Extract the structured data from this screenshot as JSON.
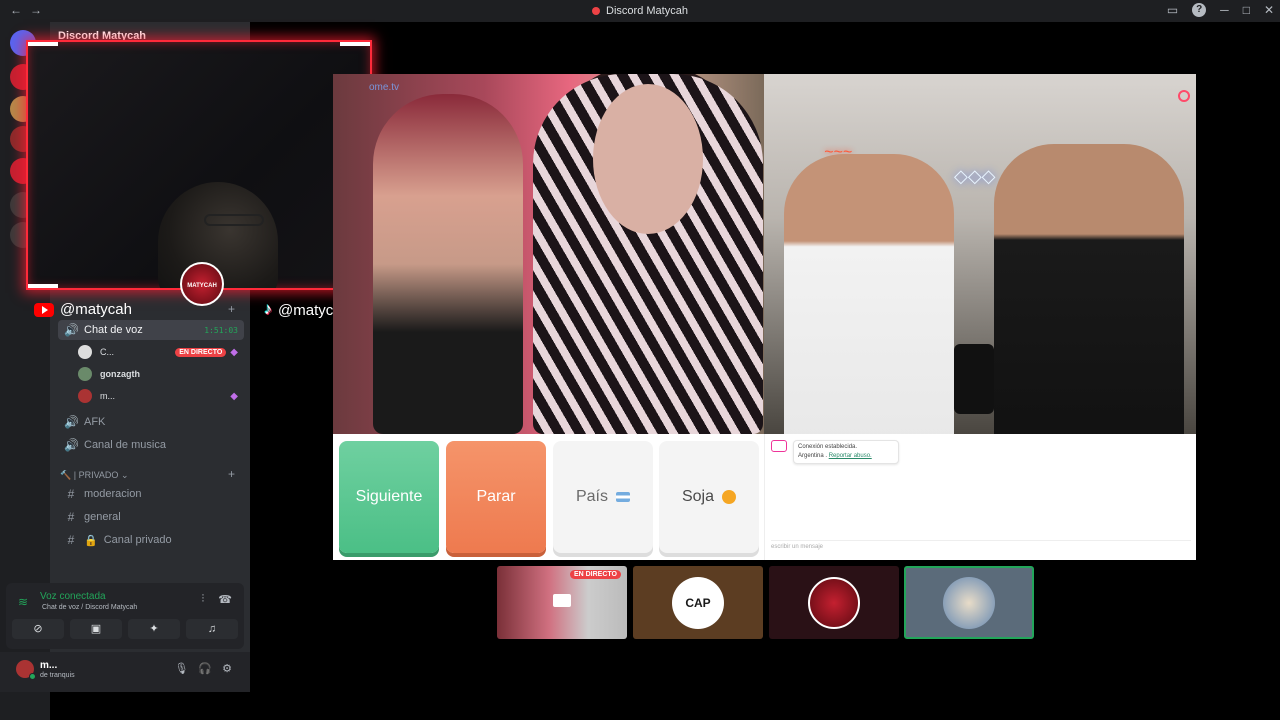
{
  "window": {
    "title": "Discord Matycah"
  },
  "server": {
    "name": "Discord Matycah"
  },
  "socials": {
    "youtube": "@matycah",
    "tiktok": "@matycah"
  },
  "channels": {
    "voice_active": {
      "label": "Chat de voz",
      "timer": "1:51:03"
    },
    "members": [
      {
        "name": "C...",
        "badge": "EN DIRECTO"
      },
      {
        "name": "gonzagth",
        "badge": ""
      },
      {
        "name": "m...",
        "badge": ""
      }
    ],
    "afk": "AFK",
    "music": "Canal de musica",
    "category_private": "| PRIVADO",
    "moderation": "moderacion",
    "general": "general",
    "private_channel": "Canal privado"
  },
  "voice_panel": {
    "status": "Voz conectada",
    "location": "Chat de voz / Discord Matycah"
  },
  "user": {
    "name": "m...",
    "status": "de tranquis"
  },
  "stream": {
    "watermark": "ome.tv",
    "buttons": {
      "next": "Siguiente",
      "stop": "Parar",
      "country": "País",
      "gender": "Soja"
    },
    "chat": {
      "connection": "Conexión establecida.",
      "country": "Argentina",
      "report": "Reportar abuso.",
      "placeholder": "escribir un mensaje"
    }
  },
  "thumbnails": {
    "live_badge": "EN DIRECTO",
    "cap_label": "CAP"
  },
  "webcam_badge": "MATYCAH"
}
